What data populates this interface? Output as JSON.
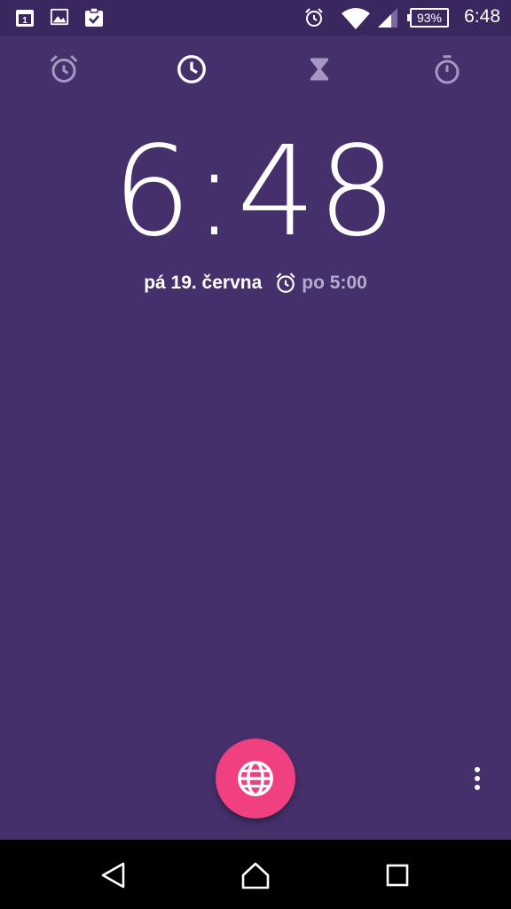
{
  "status_bar": {
    "calendar_day": "1",
    "battery_level": "93%",
    "time": "6:48",
    "icons": [
      "calendar-icon",
      "image-icon",
      "clipboard-check-icon",
      "alarm-icon",
      "wifi-icon",
      "signal-icon",
      "battery-icon"
    ]
  },
  "tabs": [
    {
      "name": "alarm-tab",
      "icon": "alarm-clock-icon",
      "selected": false
    },
    {
      "name": "clock-tab",
      "icon": "clock-icon",
      "selected": true
    },
    {
      "name": "timer-tab",
      "icon": "hourglass-icon",
      "selected": false
    },
    {
      "name": "stopwatch-tab",
      "icon": "stopwatch-icon",
      "selected": false
    }
  ],
  "clock": {
    "time": "6:48",
    "date": "pá 19. června",
    "next_alarm": "po 5:00"
  },
  "fab": {
    "icon": "globe-icon"
  },
  "colors": {
    "background": "#46306c",
    "status_bar": "#3b2760",
    "fab": "#f0407f",
    "inactive": "#a697c3"
  }
}
